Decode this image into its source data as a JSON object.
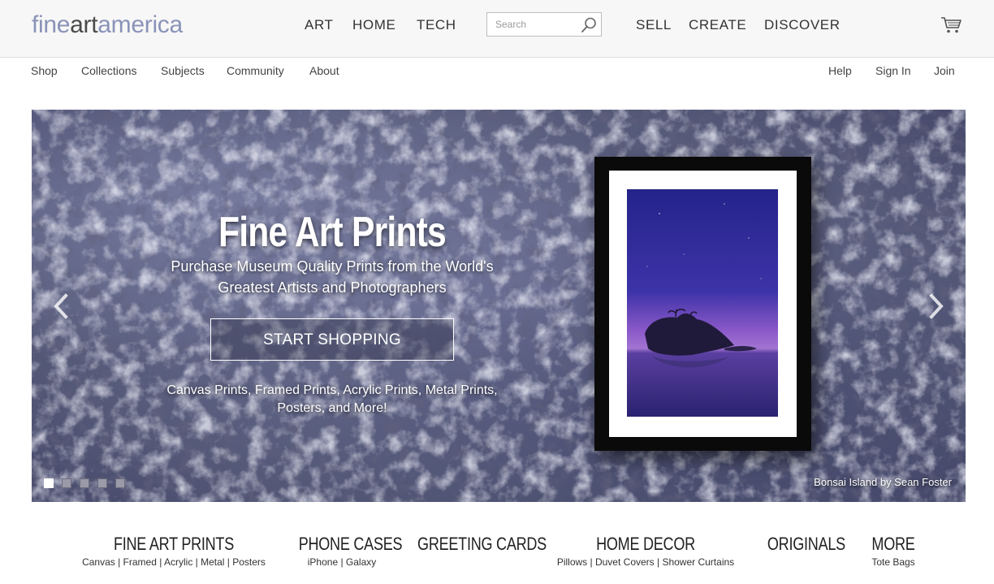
{
  "header": {
    "logo": {
      "part1": "fine",
      "part2": "art",
      "part3": "america"
    },
    "main_nav": [
      "ART",
      "HOME",
      "TECH",
      "SELL",
      "CREATE",
      "DISCOVER"
    ],
    "search": {
      "placeholder": "Search",
      "value": ""
    },
    "icons": {
      "search": "search-icon",
      "cart": "cart-icon"
    }
  },
  "subnav": {
    "left": [
      "Shop",
      "Collections",
      "Subjects",
      "Community",
      "About"
    ],
    "right": [
      "Help",
      "Sign In",
      "Join"
    ]
  },
  "hero": {
    "title": "Fine Art Prints",
    "subtitle_line1": "Purchase Museum Quality Prints from the World's",
    "subtitle_line2": "Greatest Artists and Photographers",
    "cta_label": "START SHOPPING",
    "types_line1": "Canvas Prints, Framed Prints, Acrylic Prints, Metal Prints,",
    "types_line2": "Posters, and More!",
    "credit": "Bonsai Island by Sean Foster",
    "slide_count": 5,
    "active_slide": 1,
    "icons": {
      "prev": "chevron-left-icon",
      "next": "chevron-right-icon"
    }
  },
  "categories": [
    {
      "title": "FINE ART PRINTS",
      "links": "Canvas | Framed | Acrylic | Metal | Posters"
    },
    {
      "title": "PHONE CASES",
      "links": "iPhone | Galaxy"
    },
    {
      "title": "GREETING CARDS",
      "links": ""
    },
    {
      "title": "HOME DECOR",
      "links": "Pillows | Duvet Covers | Shower Curtains"
    },
    {
      "title": "ORIGINALS",
      "links": ""
    },
    {
      "title": "MORE",
      "links": "Tote Bags"
    }
  ],
  "colors": {
    "logo_accent": "#8a93b8",
    "logo_dark": "#4a4a4a",
    "header_bg": "#f7f7f7",
    "hero_bg": "#5c6082"
  }
}
